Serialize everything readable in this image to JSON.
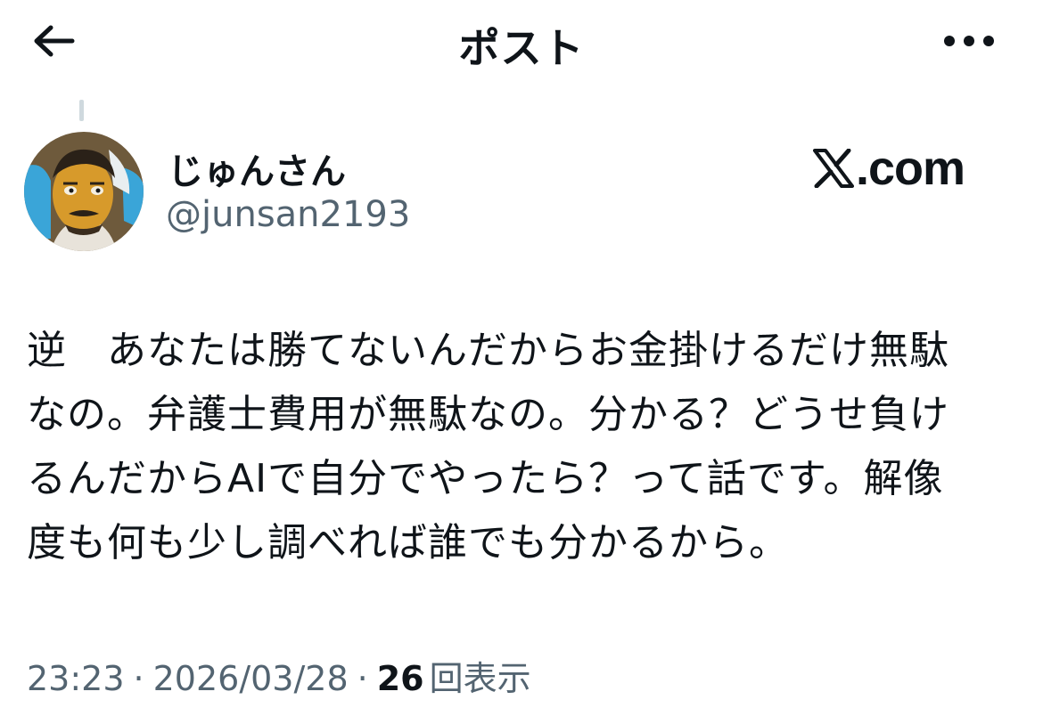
{
  "header": {
    "title": "ポスト",
    "back_icon": "back-arrow-icon",
    "more_icon": "more-horizontal-icon"
  },
  "author": {
    "display_name": "じゅんさん",
    "handle": "@junsan2193",
    "avatar": "cartoon-portrait-avatar"
  },
  "brand": {
    "text": ".com",
    "icon": "x-logo-icon"
  },
  "post": {
    "text": "逆　あなたは勝てないんだからお金掛けるだけ無駄\nなの。弁護士費用が無駄なの。分かる？どうせ負け\nるんだからAIで自分でやったら？って話です。解像\n度も何も少し調べれば誰でも分かるから。"
  },
  "meta": {
    "time": "23:23",
    "separator": "·",
    "date": "2026/03/28",
    "views_count": "26",
    "views_label": "回表示"
  },
  "colors": {
    "text_primary": "#0f1419",
    "text_secondary": "#536471",
    "thread_line": "#cfd9de",
    "background": "#ffffff"
  }
}
